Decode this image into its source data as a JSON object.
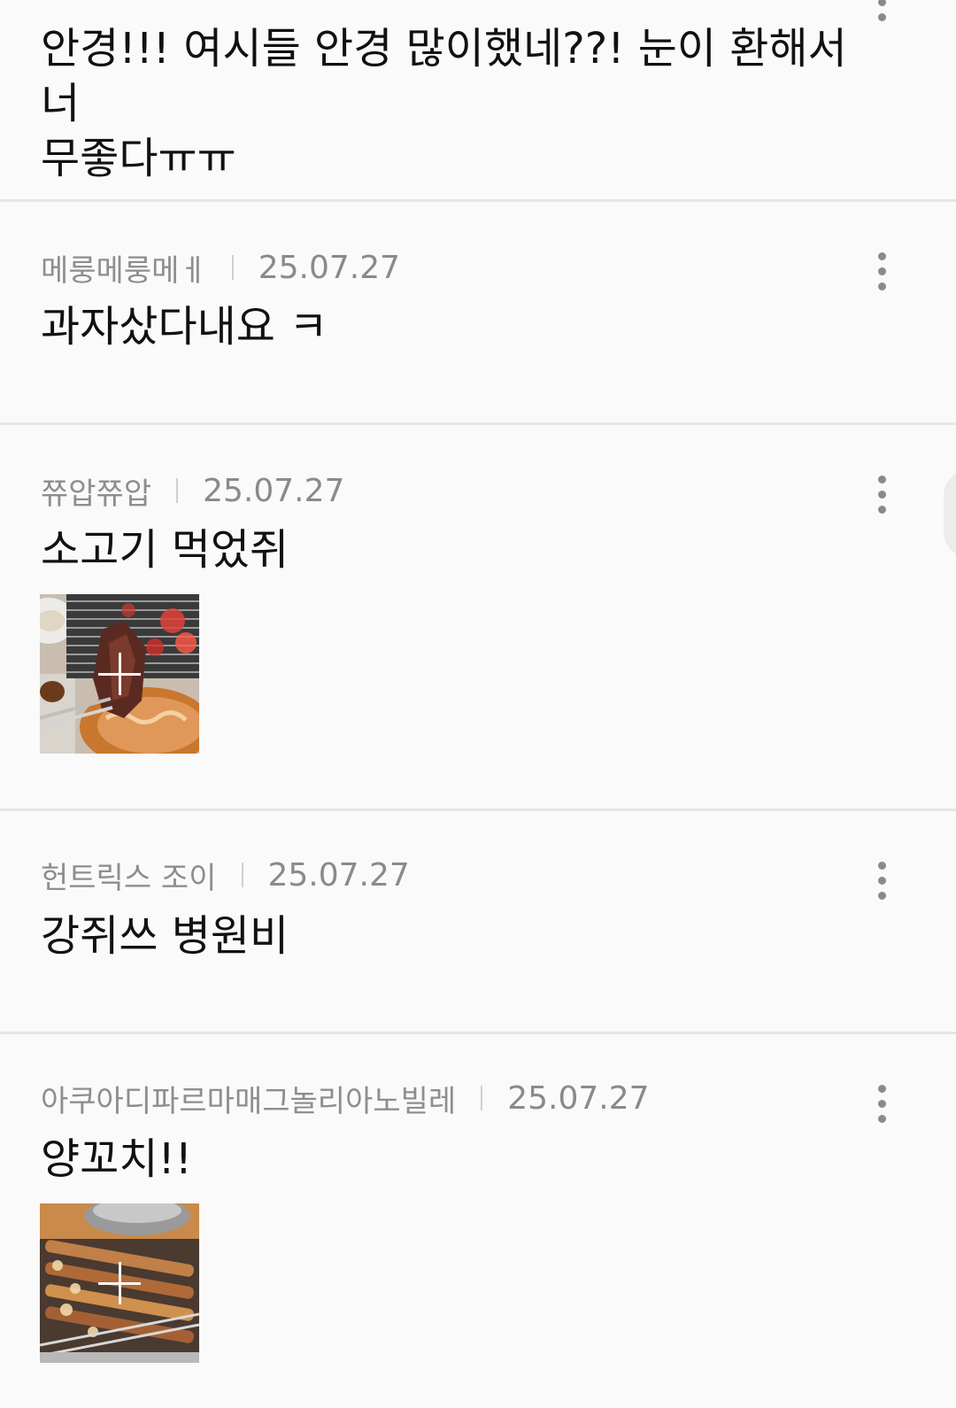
{
  "posts": [
    {
      "author": "",
      "date": "",
      "text_line1": "안경!!! 여시들 안경 많이했네??! 눈이 환해서 너",
      "text_line2": "무좋다ㅠㅠ"
    },
    {
      "author": "메룽메룽메ㅔ",
      "date": "25.07.27",
      "text": "과자샀다내요 ㅋ"
    },
    {
      "author": "쮸압쮸압",
      "date": "25.07.27",
      "text": "소고기 먹었쥐",
      "image": "grilled-beef-photo"
    },
    {
      "author": "헌트릭스 조이",
      "date": "25.07.27",
      "text": "강쥐쓰 병원비"
    },
    {
      "author": "아쿠아디파르마매그놀리아노빌레",
      "date": "25.07.27",
      "text": "양꼬치!!",
      "image": "lamb-skewers-photo"
    }
  ],
  "icons": {
    "more": "more-vertical-icon",
    "expand": "plus-icon"
  },
  "colors": {
    "background": "#fafafa",
    "divider": "#e6e6e6",
    "meta_text": "#8e8e8e",
    "body_text": "#111111"
  }
}
